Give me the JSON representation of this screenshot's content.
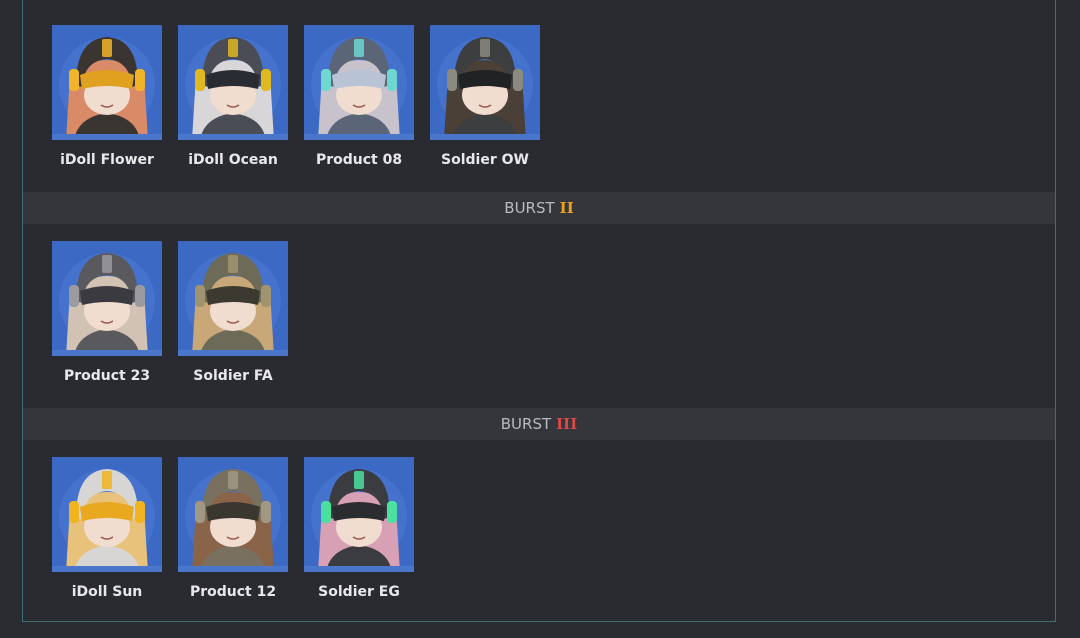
{
  "sections": [
    {
      "heading": null,
      "characters": [
        {
          "name": "iDoll Flower",
          "hair": "#d98a66",
          "helmet": "#3a3530",
          "accent": "#f0b428",
          "visor": "#e0a020"
        },
        {
          "name": "iDoll Ocean",
          "hair": "#d8d6d8",
          "helmet": "#4a4d55",
          "accent": "#e0b820",
          "visor": "#2a2c33"
        },
        {
          "name": "Product 08",
          "hair": "#c8c2cc",
          "helmet": "#5a6577",
          "accent": "#6fd6d0",
          "visor": "#b8c4d6"
        },
        {
          "name": "Soldier OW",
          "hair": "#4a4038",
          "helmet": "#3c3e40",
          "accent": "#8a8a80",
          "visor": "#202224"
        }
      ]
    },
    {
      "heading": {
        "label": "BURST",
        "numeral": "II",
        "numeral_color": "#f0a21c"
      },
      "characters": [
        {
          "name": "Product 23",
          "hair": "#d2c2b4",
          "helmet": "#5a5a5e",
          "accent": "#9a9aa0",
          "visor": "#3a3a40"
        },
        {
          "name": "Soldier FA",
          "hair": "#c8a878",
          "helmet": "#6e6a58",
          "accent": "#a09470",
          "visor": "#3c3a30"
        }
      ]
    },
    {
      "heading": {
        "label": "BURST",
        "numeral": "III",
        "numeral_color": "#e04848"
      },
      "characters": [
        {
          "name": "iDoll Sun",
          "hair": "#e8c27a",
          "helmet": "#d8d6d4",
          "accent": "#f0b420",
          "visor": "#e8a820"
        },
        {
          "name": "Product 12",
          "hair": "#8a6448",
          "helmet": "#7a7060",
          "accent": "#a09884",
          "visor": "#3a3630"
        },
        {
          "name": "Soldier EG",
          "hair": "#d8a0b4",
          "helmet": "#3a3c40",
          "accent": "#4ae0a0",
          "visor": "#2a2c30"
        }
      ]
    }
  ]
}
